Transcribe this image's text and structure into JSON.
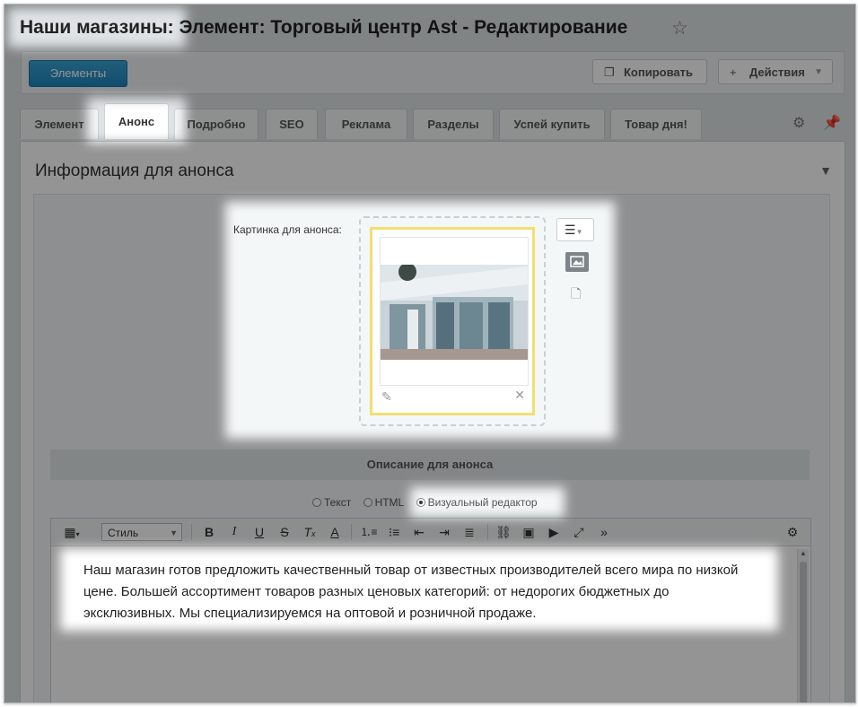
{
  "page": {
    "title_prefix": "Наши магазины:",
    "title_rest": " Элемент: Торговый центр Ast - Редактирование",
    "star_icon": "☆"
  },
  "toolbar": {
    "elements_label": "Элементы",
    "copy_label": "Копировать",
    "actions_label": "Действия"
  },
  "tabs": [
    {
      "label": "Элемент"
    },
    {
      "label": "Анонс"
    },
    {
      "label": "Подробно"
    },
    {
      "label": "SEO"
    },
    {
      "label": "Реклама"
    },
    {
      "label": "Разделы"
    },
    {
      "label": "Успей купить"
    },
    {
      "label": "Товар дня!"
    }
  ],
  "panel": {
    "title": "Информация для анонса",
    "picture_label": "Картинка для анонса:",
    "description_header": "Описание для анонса"
  },
  "editor_mode": {
    "options": [
      "Текст",
      "HTML",
      "Визуальный редактор"
    ],
    "selected": "Визуальный редактор"
  },
  "editor": {
    "style_select": "Стиль",
    "text_lines": [
      "Наш магазин готов предложить качественный товар от известных производителей всего мира по низкой",
      "цене. Большей ассортимент товаров разных ценовых категорий: от недорогих бюджетных до",
      "эксклюзивных. Мы специализируемся на оптовой и розничной продаже."
    ]
  },
  "colors": {
    "accent": "#1d84bd",
    "highlight": "#f1df72"
  }
}
